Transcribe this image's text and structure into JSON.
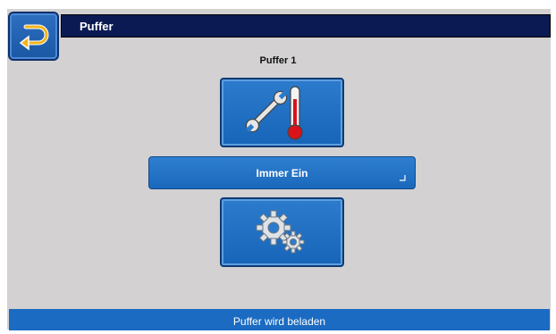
{
  "header": {
    "title": "Puffer",
    "back_icon": "return-arrow-icon"
  },
  "main": {
    "subtitle": "Puffer 1",
    "tiles": [
      {
        "icon": "wrench-thermometer-icon"
      },
      {
        "icon": "gears-icon"
      }
    ],
    "mode": {
      "label": "Immer Ein",
      "corner_icon": "corner-arrow-icon"
    }
  },
  "status": {
    "text": "Puffer wird beladen"
  },
  "colors": {
    "title_bar": "#0c1a54",
    "tile": "#1e6fc2",
    "status_bar": "#1b6bc2",
    "background": "#d3d1d2",
    "accent_yellow": "#f2b51d"
  }
}
